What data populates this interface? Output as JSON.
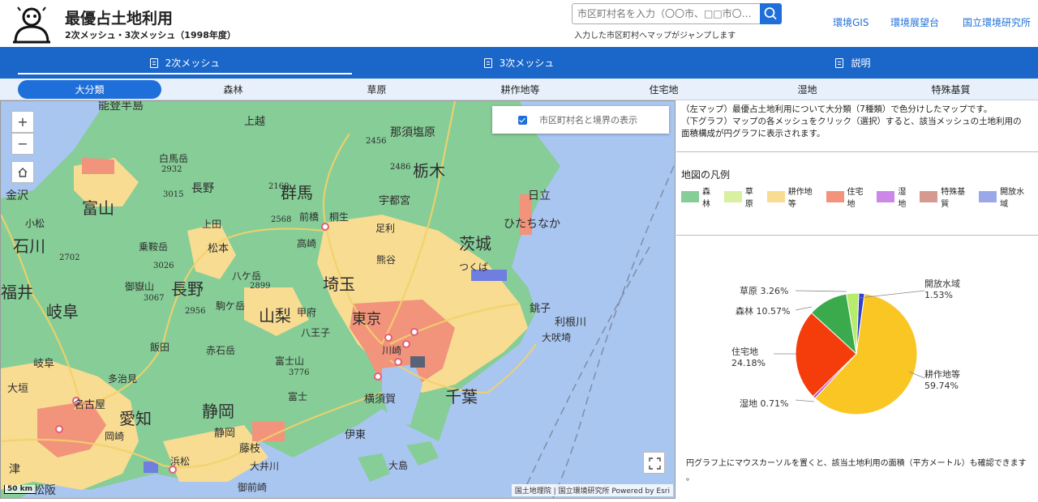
{
  "header": {
    "title": "最優占土地利用",
    "subtitle": "2次メッシュ・3次メッシュ（1998年度）",
    "search_placeholder": "市区町村名を入力（〇〇市、□□市〇…",
    "search_hint": "入力した市区町村へマップがジャンプします",
    "links": [
      "環境GIS",
      "環境展望台",
      "国立環境研究所"
    ]
  },
  "main_tabs": [
    "2次メッシュ",
    "3次メッシュ",
    "説明"
  ],
  "sub_tabs": [
    "大分類",
    "森林",
    "草原",
    "耕作地等",
    "住宅地",
    "湿地",
    "特殊基質"
  ],
  "map": {
    "layer_toggle_label": "市区町村名と境界の表示",
    "scale_label": "50 km",
    "attribution": "国土地理院 | 国立環境研究所   Powered by Esri",
    "place_labels": [
      {
        "text": "能登半島",
        "size": 14
      },
      {
        "text": "上越",
        "size": 13
      },
      {
        "text": "那須塩原",
        "size": 14
      },
      {
        "text": "白馬岳",
        "size": 12
      },
      {
        "text": "2932",
        "size": 10
      },
      {
        "text": "2456",
        "size": 10
      },
      {
        "text": "2486",
        "size": 10
      },
      {
        "text": "栃木",
        "size": 20
      },
      {
        "text": "金沢",
        "size": 14
      },
      {
        "text": "3015",
        "size": 10
      },
      {
        "text": "長野",
        "size": 14
      },
      {
        "text": "2160",
        "size": 10
      },
      {
        "text": "群馬",
        "size": 20
      },
      {
        "text": "宇都宮",
        "size": 13
      },
      {
        "text": "日立",
        "size": 14
      },
      {
        "text": "富山",
        "size": 20
      },
      {
        "text": "2568",
        "size": 10
      },
      {
        "text": "前橋",
        "size": 12
      },
      {
        "text": "桐生",
        "size": 12
      },
      {
        "text": "ひたちなか",
        "size": 14
      },
      {
        "text": "小松",
        "size": 12
      },
      {
        "text": "上田",
        "size": 12
      },
      {
        "text": "足利",
        "size": 12
      },
      {
        "text": "石川",
        "size": 20
      },
      {
        "text": "乗鞍岳",
        "size": 12
      },
      {
        "text": "松本",
        "size": 13
      },
      {
        "text": "高崎",
        "size": 12
      },
      {
        "text": "茨城",
        "size": 20
      },
      {
        "text": "2702",
        "size": 10
      },
      {
        "text": "3026",
        "size": 10
      },
      {
        "text": "熊谷",
        "size": 12
      },
      {
        "text": "つくば",
        "size": 12
      },
      {
        "text": "御嶽山",
        "size": 12
      },
      {
        "text": "長野",
        "size": 20
      },
      {
        "text": "八ケ岳",
        "size": 12
      },
      {
        "text": "2899",
        "size": 10
      },
      {
        "text": "3067",
        "size": 10
      },
      {
        "text": "埼玉",
        "size": 20
      },
      {
        "text": "福井",
        "size": 20
      },
      {
        "text": "岐阜",
        "size": 20
      },
      {
        "text": "2956",
        "size": 10
      },
      {
        "text": "駒ケ岳",
        "size": 12
      },
      {
        "text": "甲府",
        "size": 12
      },
      {
        "text": "山梨",
        "size": 20
      },
      {
        "text": "銚子",
        "size": 13
      },
      {
        "text": "東京",
        "size": 18
      },
      {
        "text": "利根川",
        "size": 13
      },
      {
        "text": "赤石岳",
        "size": 12
      },
      {
        "text": "八王子",
        "size": 12
      },
      {
        "text": "飯田",
        "size": 12
      },
      {
        "text": "大吠埼",
        "size": 12
      },
      {
        "text": "岐阜",
        "size": 13
      },
      {
        "text": "富士山",
        "size": 12
      },
      {
        "text": "多治見",
        "size": 12
      },
      {
        "text": "3776",
        "size": 10
      },
      {
        "text": "大垣",
        "size": 13
      },
      {
        "text": "川崎",
        "size": 12
      },
      {
        "text": "千葉",
        "size": 20
      },
      {
        "text": "横須賀",
        "size": 13
      },
      {
        "text": "名古屋",
        "size": 13
      },
      {
        "text": "富士",
        "size": 12
      },
      {
        "text": "静岡",
        "size": 20
      },
      {
        "text": "愛知",
        "size": 20
      },
      {
        "text": "静岡",
        "size": 13
      },
      {
        "text": "伊東",
        "size": 13
      },
      {
        "text": "岡崎",
        "size": 12
      },
      {
        "text": "藤枝",
        "size": 13
      },
      {
        "text": "大島",
        "size": 12
      },
      {
        "text": "浜松",
        "size": 12
      },
      {
        "text": "大井川",
        "size": 12
      },
      {
        "text": "御前崎",
        "size": 12
      },
      {
        "text": "津",
        "size": 14
      },
      {
        "text": "松阪",
        "size": 14
      }
    ]
  },
  "panel": {
    "description": [
      "（左マップ）最優占土地利用について大分類（7種類）で色分けしたマップです。",
      "（下グラフ）マップの各メッシュをクリック（選択）すると、該当メッシュの土地利用の",
      "面積構成が円グラフに表示されます。"
    ],
    "legend_title": "地図の凡例",
    "legend": [
      {
        "label": "森林",
        "color": "#86cd97"
      },
      {
        "label": "草原",
        "color": "#d8f0a0"
      },
      {
        "label": "耕作地等",
        "color": "#f7dc92"
      },
      {
        "label": "住宅地",
        "color": "#f2937c"
      },
      {
        "label": "湿地",
        "color": "#cc88e6"
      },
      {
        "label": "特殊基質",
        "color": "#d49a90"
      },
      {
        "label": "開放水域",
        "color": "#9aa8e8"
      }
    ],
    "pie_note": "円グラフ上にマウスカーソルを置くと、該当土地利用の面積（平方メートル）も確認できます",
    "pie_note_suffix": "。"
  },
  "chart_data": {
    "type": "pie",
    "slices": [
      {
        "label": "開放水域",
        "value": 1.53,
        "value_label": "1.53%",
        "color": "#2f40c9"
      },
      {
        "label": "耕作地等",
        "value": 59.74,
        "value_label": "59.74%",
        "color": "#f9c623"
      },
      {
        "label": "湿地",
        "value": 0.71,
        "value_label": "0.71%",
        "color": "#b548d8"
      },
      {
        "label": "住宅地",
        "value": 24.18,
        "value_label": "24.18%",
        "color": "#f43d0a"
      },
      {
        "label": "森林",
        "value": 10.57,
        "value_label": "10.57%",
        "color": "#3aaa4c"
      },
      {
        "label": "草原",
        "value": 3.26,
        "value_label": "3.26%",
        "color": "#b7ec6c"
      }
    ]
  }
}
